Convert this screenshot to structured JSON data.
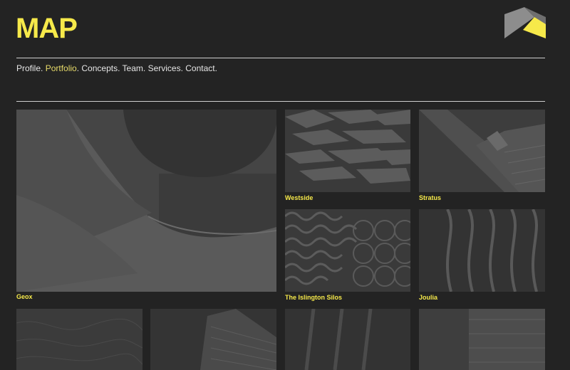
{
  "brand": {
    "name": "MAP",
    "accent_color": "#f6e94a"
  },
  "nav": {
    "items": [
      {
        "label": "Profile",
        "sep": ". "
      },
      {
        "label": "Portfolio",
        "sep": ". ",
        "active": true
      },
      {
        "label": "Concepts",
        "sep": ". "
      },
      {
        "label": "Team",
        "sep": ". "
      },
      {
        "label": "Services",
        "sep": ". "
      },
      {
        "label": "Contact",
        "sep": "."
      }
    ]
  },
  "portfolio": {
    "projects": [
      {
        "title": "Geox"
      },
      {
        "title": "Westside"
      },
      {
        "title": "Stratus"
      },
      {
        "title": "The Islington Silos"
      },
      {
        "title": "Joulia"
      }
    ]
  }
}
